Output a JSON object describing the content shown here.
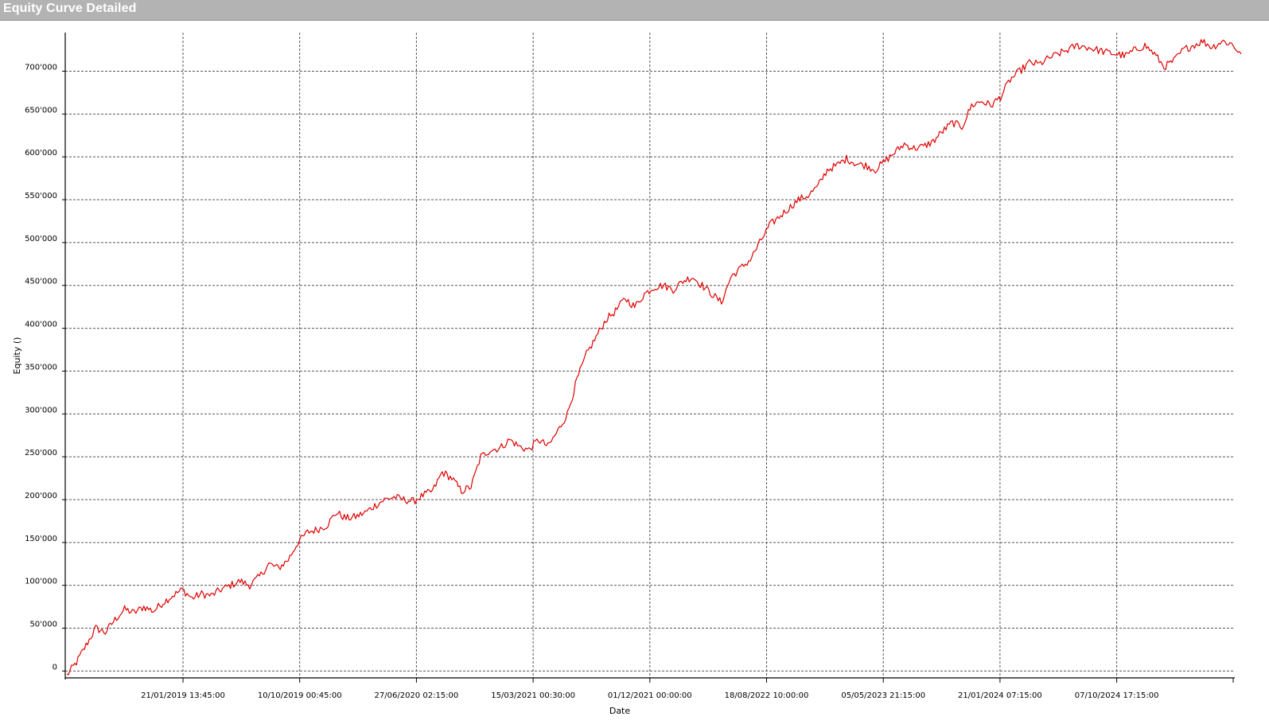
{
  "window": {
    "title": "Equity Curve Detailed"
  },
  "colors": {
    "title_bar": "#b3b3b3",
    "title_text": "#ffffff",
    "series_line": "#e00000",
    "grid": "#555555",
    "axis": "#000000"
  },
  "chart_data": {
    "type": "line",
    "xlabel": "Date",
    "ylabel": "Equity ()",
    "ylim": [
      -8000,
      745000
    ],
    "grid": true,
    "legend": "none",
    "x_ticks": [
      "21/01/2019 13:45:00",
      "10/10/2019 00:45:00",
      "27/06/2020 02:15:00",
      "15/03/2021 00:30:00",
      "01/12/2021 00:00:00",
      "18/08/2022 10:00:00",
      "05/05/2023 21:15:00",
      "21/01/2024 07:15:00",
      "07/10/2024 17:15:00"
    ],
    "y_ticks": [
      {
        "value": 0,
        "label": "0"
      },
      {
        "value": 50000,
        "label": "50'000"
      },
      {
        "value": 100000,
        "label": "100'000"
      },
      {
        "value": 150000,
        "label": "150'000"
      },
      {
        "value": 200000,
        "label": "200'000"
      },
      {
        "value": 250000,
        "label": "250'000"
      },
      {
        "value": 300000,
        "label": "300'000"
      },
      {
        "value": 350000,
        "label": "350'000"
      },
      {
        "value": 400000,
        "label": "400'000"
      },
      {
        "value": 450000,
        "label": "450'000"
      },
      {
        "value": 500000,
        "label": "500'000"
      },
      {
        "value": 550000,
        "label": "550'000"
      },
      {
        "value": 600000,
        "label": "600'000"
      },
      {
        "value": 650000,
        "label": "650'000"
      },
      {
        "value": 700000,
        "label": "700'000"
      }
    ],
    "series": [
      {
        "color": "#e00000",
        "values": [
          -5000,
          10000,
          30000,
          50000,
          45000,
          60000,
          72000,
          68000,
          75000,
          70000,
          80000,
          88000,
          95000,
          85000,
          90000,
          88000,
          95000,
          100000,
          105000,
          100000,
          110000,
          125000,
          120000,
          130000,
          150000,
          162000,
          165000,
          170000,
          185000,
          178000,
          180000,
          185000,
          193000,
          200000,
          203000,
          200000,
          198000,
          205000,
          210000,
          232000,
          225000,
          210000,
          215000,
          250000,
          258000,
          260000,
          270000,
          262000,
          258000,
          270000,
          262000,
          280000,
          300000,
          340000,
          370000,
          390000,
          410000,
          420000,
          435000,
          425000,
          440000,
          448000,
          450000,
          445000,
          455000,
          460000,
          450000,
          440000,
          430000,
          460000,
          470000,
          480000,
          500000,
          520000,
          530000,
          540000,
          550000,
          555000,
          565000,
          585000,
          590000,
          598000,
          592000,
          590000,
          585000,
          595000,
          605000,
          615000,
          610000,
          612000,
          618000,
          630000,
          640000,
          635000,
          660000,
          665000,
          660000,
          670000,
          690000,
          700000,
          710000,
          708000,
          715000,
          720000,
          725000,
          730000,
          728000,
          725000,
          722000,
          720000,
          718000,
          725000,
          730000,
          720000,
          705000,
          712000,
          725000,
          730000,
          735000,
          728000,
          735000,
          732000,
          720000
        ]
      }
    ]
  }
}
